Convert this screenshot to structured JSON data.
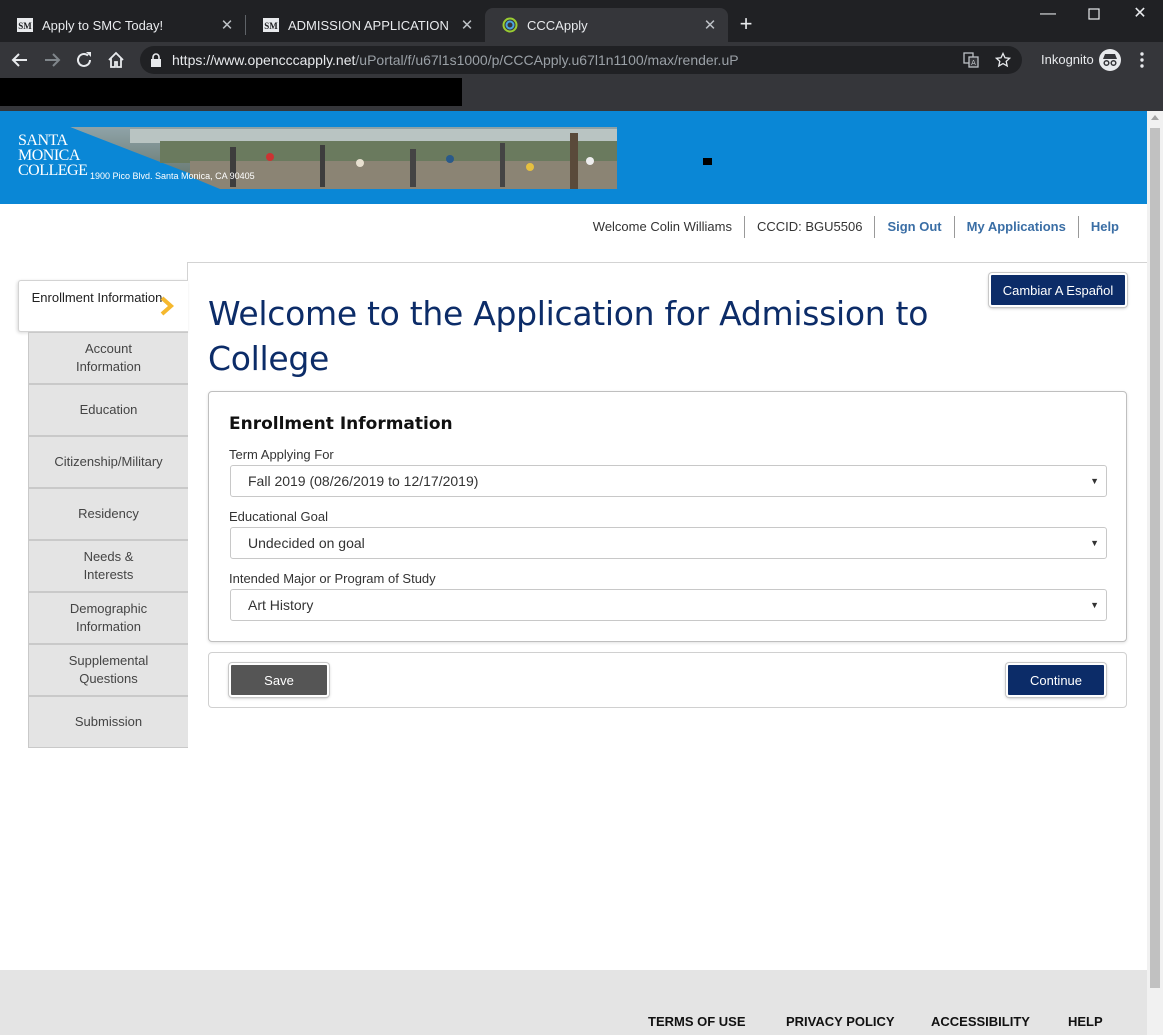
{
  "browser": {
    "tabs": [
      {
        "title": "Apply to SMC Today!",
        "active": false
      },
      {
        "title": "ADMISSION APPLICATION",
        "active": false
      },
      {
        "title": "CCCApply",
        "active": true
      }
    ],
    "url_host": "https://www.opencccapply.net",
    "url_path": "/uPortal/f/u67l1s1000/p/CCCApply.u67l1n1100/max/render.uP",
    "profile_label": "Inkognito"
  },
  "banner": {
    "logo_line1": "SANTA",
    "logo_line2": "MONICA",
    "logo_line3": "COLLEGE",
    "address": "1900 Pico Blvd. Santa Monica, CA 90405",
    "color": "#0a87d6"
  },
  "userbar": {
    "welcome": "Welcome Colin Williams",
    "cccid": "CCCID: BGU5506",
    "sign_out": "Sign Out",
    "my_applications": "My Applications",
    "help": "Help"
  },
  "sidebar": {
    "items": [
      {
        "label": "Enrollment Information",
        "active": true
      },
      {
        "label": "Account Information",
        "active": false
      },
      {
        "label": "Education",
        "active": false
      },
      {
        "label": "Citizenship/Military",
        "active": false
      },
      {
        "label": "Residency",
        "active": false
      },
      {
        "label": "Needs & Interests",
        "active": false
      },
      {
        "label": "Demographic Information",
        "active": false
      },
      {
        "label": "Supplemental Questions",
        "active": false
      },
      {
        "label": "Submission",
        "active": false
      }
    ]
  },
  "main": {
    "language_button": "Cambiar A Español",
    "title": "Welcome to the Application for Admission to College",
    "section_heading": "Enrollment Information",
    "fields": [
      {
        "label": "Term Applying For",
        "value": "Fall 2019 (08/26/2019 to 12/17/2019)"
      },
      {
        "label": "Educational Goal",
        "value": "Undecided on goal"
      },
      {
        "label": "Intended Major or Program of Study",
        "value": "Art History"
      }
    ],
    "save_label": "Save",
    "continue_label": "Continue"
  },
  "footer": {
    "links": [
      "TERMS OF USE",
      "PRIVACY POLICY",
      "ACCESSIBILITY",
      "HELP"
    ]
  },
  "colors": {
    "navy": "#0c2c68",
    "accent_chevron": "#f5b82e"
  }
}
